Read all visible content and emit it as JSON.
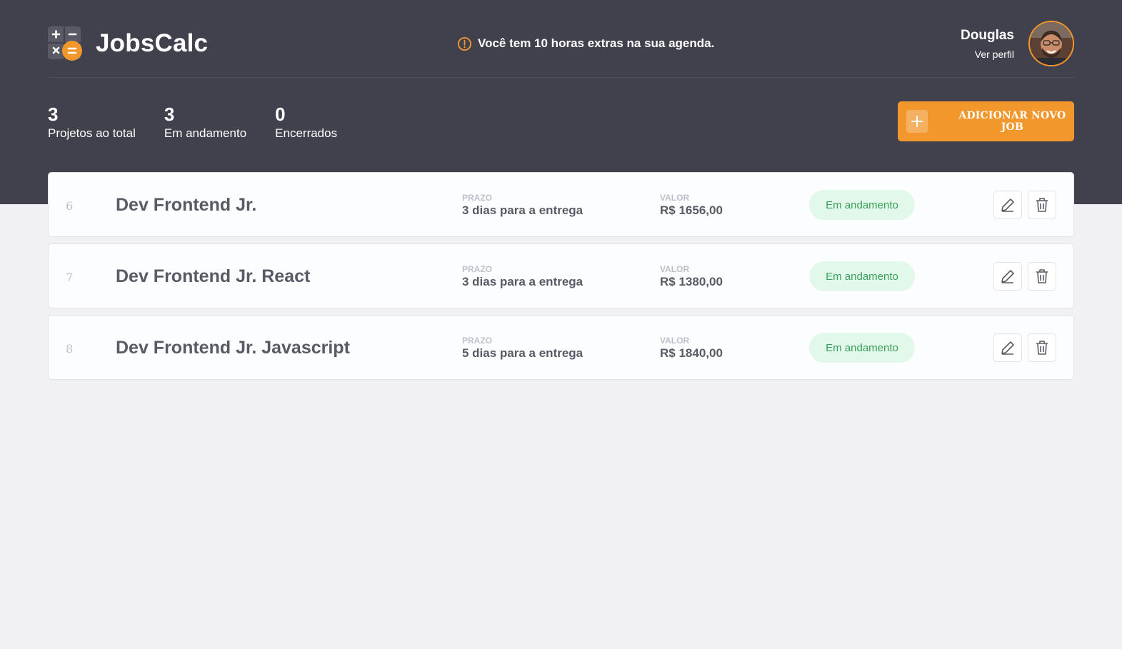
{
  "header": {
    "brand": "JobsCalc",
    "notice": "Você tem 10 horas extras na sua agenda.",
    "profile": {
      "name": "Douglas",
      "link": "Ver perfil"
    }
  },
  "summary": [
    {
      "value": "3",
      "label": "Projetos ao total"
    },
    {
      "value": "3",
      "label": "Em andamento"
    },
    {
      "value": "0",
      "label": "Encerrados"
    }
  ],
  "add_button": {
    "label": "ADICIONAR NOVO JOB",
    "icon": "plus-icon"
  },
  "jobs": [
    {
      "id": "6",
      "name": "Dev Frontend Jr.",
      "deadline_label": "PRAZO",
      "deadline": "3 dias para a entrega",
      "value_label": "VALOR",
      "value": "R$ 1656,00",
      "status": "Em andamento"
    },
    {
      "id": "7",
      "name": "Dev Frontend Jr. React",
      "deadline_label": "PRAZO",
      "deadline": "3 dias para a entrega",
      "value_label": "VALOR",
      "value": "R$ 1380,00",
      "status": "Em andamento"
    },
    {
      "id": "8",
      "name": "Dev Frontend Jr. Javascript",
      "deadline_label": "PRAZO",
      "deadline": "5 dias para a entrega",
      "value_label": "VALOR",
      "value": "R$ 1840,00",
      "status": "Em andamento"
    }
  ],
  "colors": {
    "header_bg": "#41414D",
    "accent": "#F1972C",
    "status_bg": "#E2F8EA",
    "status_text": "#3A9E5A",
    "page_bg": "#F0F0F5"
  },
  "icons": [
    "calculator-logo-icon",
    "alert-icon",
    "plus-icon",
    "edit-icon",
    "trash-icon"
  ]
}
